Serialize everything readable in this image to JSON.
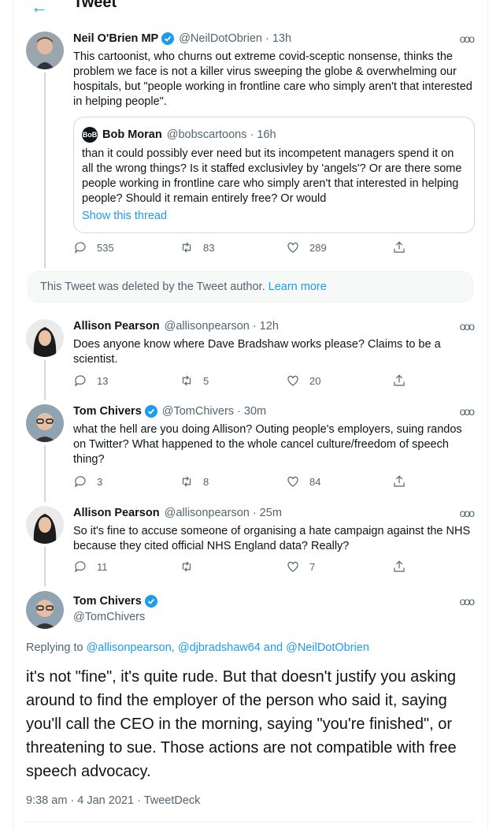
{
  "header": {
    "back_icon": "arrow-left-icon",
    "title": "Tweet"
  },
  "colors": {
    "accent": "#1d9bf0",
    "muted": "#536471",
    "text": "#0f1419"
  },
  "tweets": [
    {
      "name": "Neil O'Brien MP",
      "verified": true,
      "handle": "@NeilDotObrien",
      "time": "· 13h",
      "text": "This cartoonist, who churns out extreme covid-sceptic nonsense, thinks the problem we face is not a killer virus sweeping the globe & overwhelming our hospitals, but \"people working in frontline care who simply aren't that interested in helping people\".",
      "replies": "535",
      "retweets": "83",
      "likes": "289",
      "quote": {
        "avatar_text": "BoB",
        "name": "Bob Moran",
        "handle": "@bobscartoons",
        "time": "· 16h",
        "text": "than it could possibly ever need but its incompetent managers spend it on all the wrong things? Is it staffed exclusivley by 'angels'? Or are there some people working in frontline care who simply aren't that interested in helping people? Should it remain entirely free? Or would",
        "link": "Show this thread"
      }
    },
    {
      "name": "Allison Pearson",
      "handle": "@allisonpearson",
      "time": "· 12h",
      "text": "Does anyone know where Dave Bradshaw works please? Claims to be a scientist.",
      "replies": "13",
      "retweets": "5",
      "likes": "20"
    },
    {
      "name": "Tom Chivers",
      "verified": true,
      "handle": "@TomChivers",
      "time": "· 30m",
      "text": "what the hell are you doing Allison? Outing people's employers, suing randos on Twitter? What happened to the whole cancel culture/freedom of speech thing?",
      "replies": "3",
      "retweets": "8",
      "likes": "84"
    },
    {
      "name": "Allison Pearson",
      "handle": "@allisonpearson",
      "time": "· 25m",
      "text": "So it's fine to accuse someone of organising a hate campaign against the NHS because they cited official NHS England data?  Really?",
      "replies": "11",
      "retweets": "",
      "likes": "7"
    }
  ],
  "deleted": {
    "text": "This Tweet was deleted by the Tweet author.",
    "link": "Learn more"
  },
  "main_tweet": {
    "name": "Tom Chivers",
    "verified": true,
    "handle": "@TomChivers",
    "replying_prefix": "Replying to",
    "replying_to": "@allisonpearson, @djbradshaw64 and @NeilDotObrien",
    "text": "it's not \"fine\", it's quite rude. But that doesn't justify you asking around to find the employer of the person who said it, saying you'll call the CEO in the morning, saying \"you're finished\", or threatening to sue. Those actions are not compatible with free speech advocacy.",
    "timestamp": "9:38 am · 4 Jan 2021 ·",
    "source": "TweetDeck"
  }
}
